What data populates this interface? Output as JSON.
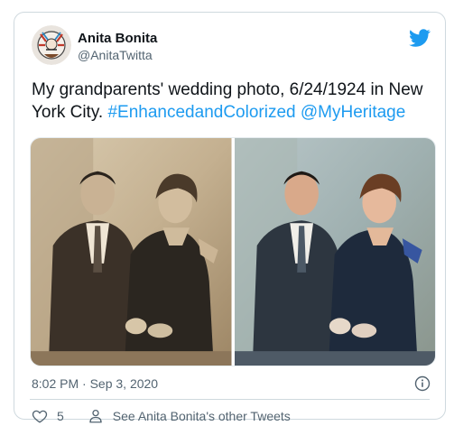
{
  "tweet": {
    "author_name": "Anita Bonita",
    "author_handle": "@AnitaTwitta",
    "text_plain": "My grandparents' wedding photo, 6/24/1924 in New York City.",
    "hashtag": "#EnhancedandColorized",
    "mention": "@MyHeritage",
    "timestamp": "8:02 PM · Sep 3, 2020",
    "like_count": "5",
    "other_tweets_label": "See Anita Bonita's other Tweets"
  },
  "icons": {
    "brand": "twitter-bird-icon",
    "info": "info-icon",
    "like": "heart-icon",
    "person": "person-icon"
  },
  "colors": {
    "accent": "#1d9bf0",
    "text_primary": "#0f1419",
    "text_secondary": "#536471",
    "border": "#cfd9de"
  }
}
